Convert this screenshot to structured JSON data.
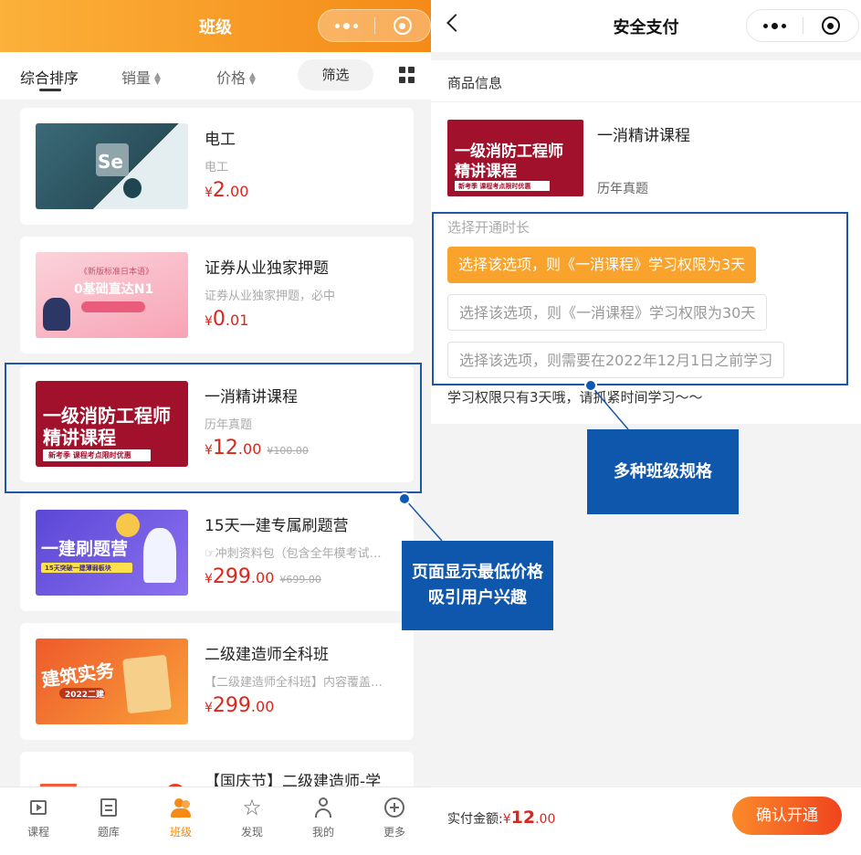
{
  "left": {
    "header": {
      "title": "班级"
    },
    "sort": {
      "items": [
        "综合排序",
        "销量",
        "价格"
      ],
      "filter_label": "筛选"
    },
    "courses": [
      {
        "title": "电工",
        "subtitle": "电工",
        "price_int": "2",
        "price_dec": ".00",
        "orig": "",
        "thumb_text": "Se"
      },
      {
        "title": "证券从业独家押题",
        "subtitle": "证券从业独家押题，必中",
        "price_int": "0",
        "price_dec": ".01",
        "orig": "",
        "thumb_text": "0基础直达N1",
        "thumb_top": "《新版标准日本语》"
      },
      {
        "title": "一消精讲课程",
        "subtitle": "历年真题",
        "price_int": "12",
        "price_dec": ".00",
        "orig": "¥100.00",
        "thumb_line1": "一级消防工程师",
        "thumb_line2": "精讲课程",
        "thumb_tag": "新考季 课程考点限时优惠"
      },
      {
        "title": "15天一建专属刷题营",
        "subtitle": "☞冲刺资料包（包含全年模考试…",
        "price_int": "299",
        "price_dec": ".00",
        "orig": "¥699.00",
        "thumb_text": "一建刷题营",
        "thumb_tag": "15天突破一建薄弱板块"
      },
      {
        "title": "二级建造师全科班",
        "subtitle": "【二级建造师全科班】内容覆盖…",
        "price_int": "299",
        "price_dec": ".00",
        "orig": "",
        "thumb_text": "建筑实务",
        "thumb_tag": "2022二建"
      },
      {
        "title": "【国庆节】二级建造师-学"
      }
    ],
    "currency": "¥",
    "nav": [
      {
        "label": "课程",
        "icon": "play-icon"
      },
      {
        "label": "题库",
        "icon": "list-icon"
      },
      {
        "label": "班级",
        "icon": "class-icon"
      },
      {
        "label": "发现",
        "icon": "star-icon"
      },
      {
        "label": "我的",
        "icon": "user-icon"
      },
      {
        "label": "更多",
        "icon": "plus-icon"
      }
    ]
  },
  "right": {
    "header": {
      "title": "安全支付"
    },
    "info_label": "商品信息",
    "product": {
      "title": "一消精讲课程",
      "subtitle": "历年真题",
      "thumb_line1": "一级消防工程师",
      "thumb_line2": "精讲课程",
      "thumb_tag": "新考季 课程考点限时优惠"
    },
    "duration_label": "选择开通时长",
    "options": [
      "选择该选项，则《一消课程》学习权限为3天",
      "选择该选项，则《一消课程》学习权限为30天",
      "选择该选项，则需要在2022年12月1日之前学习"
    ],
    "note": "学习权限只有3天哦，请抓紧时间学习～～",
    "pay": {
      "label": "实付金额:",
      "currency": "¥",
      "amount": "12",
      "decimal": ".00"
    },
    "confirm_label": "确认开通"
  },
  "annotations": {
    "lowest_price_line1": "页面显示最低价格",
    "lowest_price_line2": "吸引用户兴趣",
    "multi_spec": "多种班级规格"
  },
  "colors": {
    "brand_orange": "#f58a17",
    "price_red": "#d8271c",
    "annotation_blue": "#0f57ad"
  }
}
